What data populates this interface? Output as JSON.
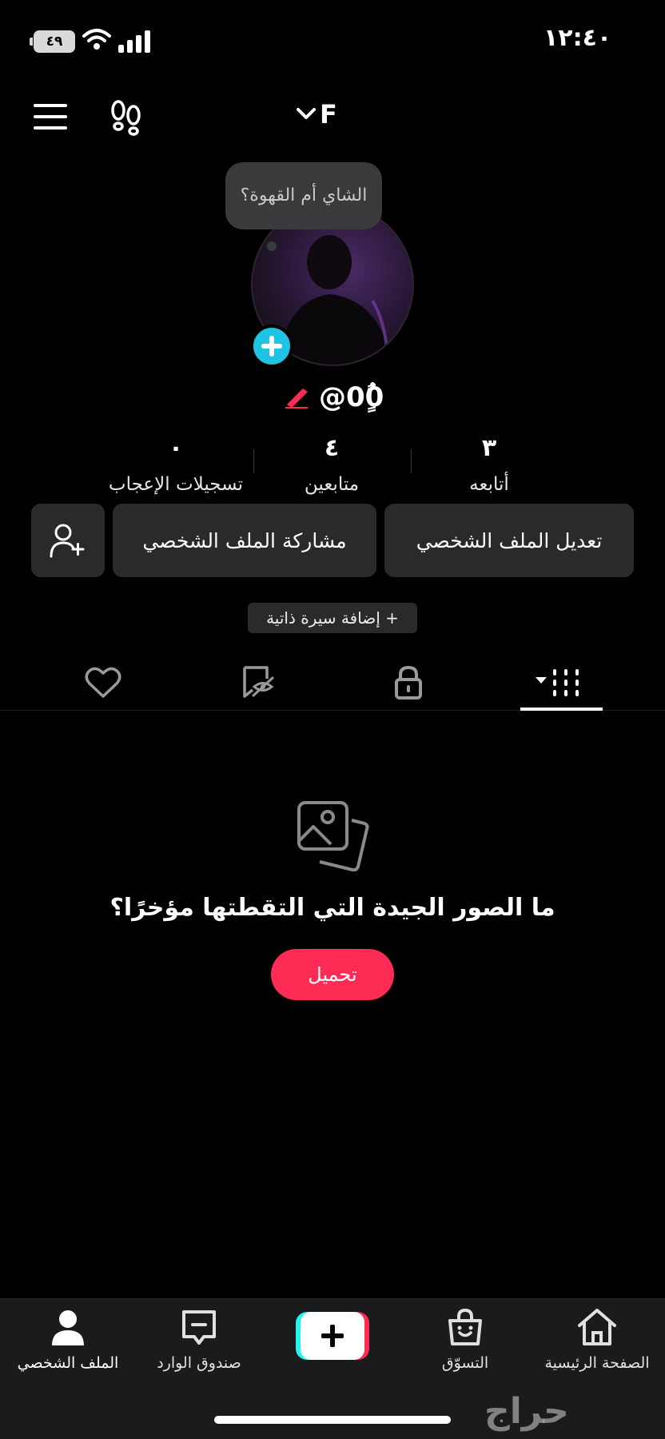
{
  "status_bar": {
    "time": "١٢:٤٠",
    "battery": "٤٩"
  },
  "top_nav": {
    "account_name": "F"
  },
  "profile": {
    "note_bubble": "الشاي أم القهوة؟",
    "username": "@0ًٍُ0",
    "stats": [
      {
        "value": "٣",
        "label": "أتابعه"
      },
      {
        "value": "٤",
        "label": "متابعين"
      },
      {
        "value": "٠",
        "label": "تسجيلات الإعجاب"
      }
    ],
    "edit_profile": "تعديل الملف الشخصي",
    "share_profile": "مشاركة الملف الشخصي",
    "add_bio": "+ إضافة سيرة ذاتية"
  },
  "empty_state": {
    "title": "ما الصور الجيدة التي التقطتها مؤخرًا؟",
    "upload_button": "تحميل"
  },
  "bottom_nav": {
    "home": "الصفحة الرئيسية",
    "shop": "التسوّق",
    "inbox": "صندوق الوارد",
    "profile": "الملف الشخصي"
  },
  "watermark": "حراج",
  "colors": {
    "accent": "#fe2c55",
    "story_add": "#1fc4e4",
    "surface": "#2a2a2c"
  }
}
